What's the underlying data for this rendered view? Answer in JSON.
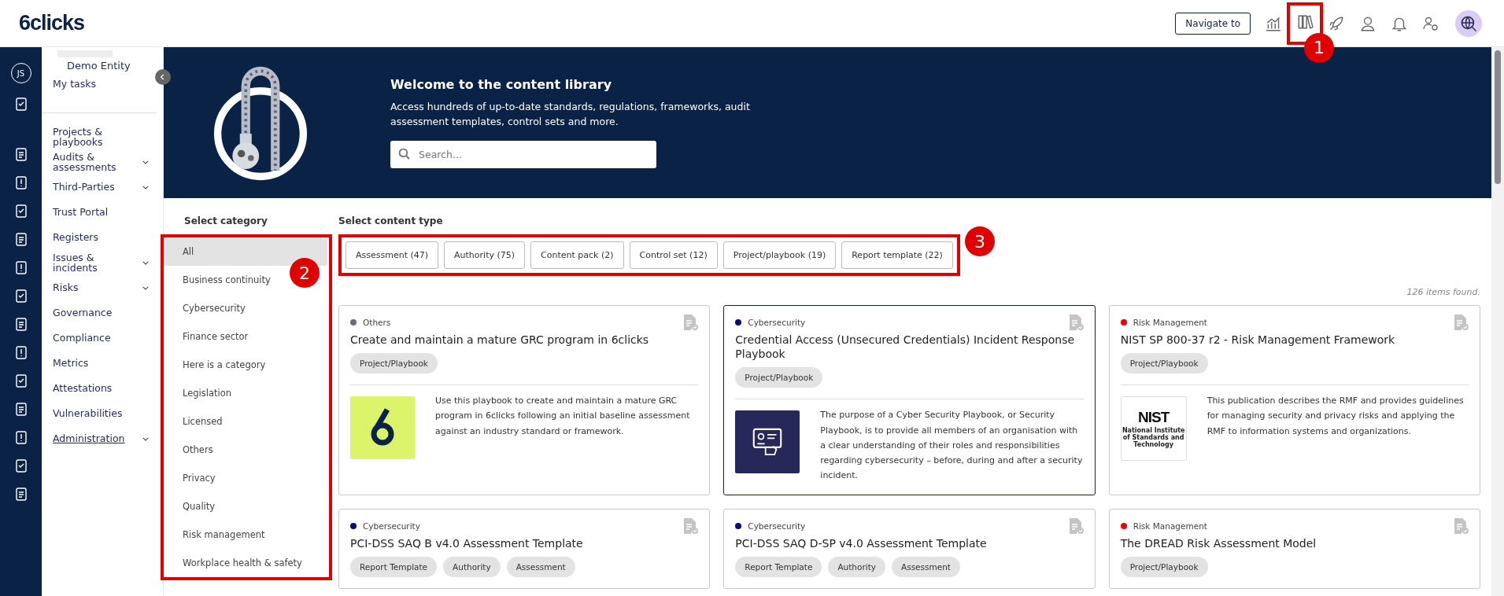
{
  "header": {
    "logo": "6clicks",
    "navigate_button": "Navigate to"
  },
  "rail": {
    "avatar_initials": "JS"
  },
  "nav": {
    "entity": "Demo Entity",
    "items": [
      {
        "label": "My tasks",
        "expandable": false,
        "hovered": false
      },
      {
        "label": "Projects & playbooks",
        "expandable": false,
        "hovered": false
      },
      {
        "label": "Audits & assessments",
        "expandable": true,
        "hovered": false
      },
      {
        "label": "Third-Parties",
        "expandable": true,
        "hovered": false
      },
      {
        "label": "Trust Portal",
        "expandable": false,
        "hovered": false
      },
      {
        "label": "Registers",
        "expandable": false,
        "hovered": false
      },
      {
        "label": "Issues & incidents",
        "expandable": true,
        "hovered": false
      },
      {
        "label": "Risks",
        "expandable": true,
        "hovered": false
      },
      {
        "label": "Governance",
        "expandable": false,
        "hovered": false
      },
      {
        "label": "Compliance",
        "expandable": false,
        "hovered": false
      },
      {
        "label": "Metrics",
        "expandable": false,
        "hovered": false
      },
      {
        "label": "Attestations",
        "expandable": false,
        "hovered": false
      },
      {
        "label": "Vulnerabilities",
        "expandable": false,
        "hovered": false
      },
      {
        "label": "Administration",
        "expandable": true,
        "hovered": true
      }
    ]
  },
  "hero": {
    "title": "Welcome to the content library",
    "text": "Access hundreds of up-to-date standards, regulations, frameworks, audit assessment templates, control sets and more.",
    "search": {
      "placeholder": "Search..."
    }
  },
  "categories": {
    "title": "Select category",
    "items": [
      {
        "label": "All",
        "selected": true
      },
      {
        "label": "Business continuity",
        "selected": false
      },
      {
        "label": "Cybersecurity",
        "selected": false
      },
      {
        "label": "Finance sector",
        "selected": false
      },
      {
        "label": "Here is a category",
        "selected": false
      },
      {
        "label": "Legislation",
        "selected": false
      },
      {
        "label": "Licensed",
        "selected": false
      },
      {
        "label": "Others",
        "selected": false
      },
      {
        "label": "Privacy",
        "selected": false
      },
      {
        "label": "Quality",
        "selected": false
      },
      {
        "label": "Risk management",
        "selected": false
      },
      {
        "label": "Workplace health & safety",
        "selected": false
      }
    ]
  },
  "content_types": {
    "title": "Select content type",
    "items": [
      "Assessment (47)",
      "Authority (75)",
      "Content pack (2)",
      "Control set (12)",
      "Project/playbook (19)",
      "Report template (22)"
    ]
  },
  "results_count": "126 items found.",
  "cards": [
    {
      "category": "Others",
      "color": "#6b6b7b",
      "title": "Create and maintain a mature GRC program in 6clicks",
      "tags": [
        "Project/Playbook"
      ],
      "thumbnail": {
        "kind": "logo"
      },
      "description": "Use this playbook to create and maintain a mature GRC program in 6clicks following an initial baseline assessment against an industry standard or framework.",
      "selected": false
    },
    {
      "category": "Cybersecurity",
      "color": "#0a0a7a",
      "title": "Credential Access (Unsecured Credentials) Incident Response Playbook",
      "tags": [
        "Project/Playbook"
      ],
      "thumbnail": {
        "kind": "icon"
      },
      "description": "The purpose of a Cyber Security Playbook, or Security Playbook, is to provide all members of an organisation with a clear understanding of their roles and responsibilities regarding cybersecurity – before, during and after a security incident.",
      "selected": true
    },
    {
      "category": "Risk Management",
      "color": "#f00000",
      "title": "NIST SP 800-37 r2 - Risk Management Framework",
      "tags": [
        "Project/Playbook"
      ],
      "thumbnail": {
        "kind": "wordmark",
        "word": "NIST",
        "caption": "National Institute of Standards and Technology"
      },
      "description": "This publication describes the RMF and provides guidelines for managing security and privacy risks and applying the RMF to information systems and organizations.",
      "selected": false
    },
    {
      "category": "Cybersecurity",
      "color": "#0a0a7a",
      "title": "PCI-DSS SAQ B v4.0 Assessment Template",
      "tags": [
        "Report Template",
        "Authority",
        "Assessment"
      ],
      "selected": false
    },
    {
      "category": "Cybersecurity",
      "color": "#0a0a7a",
      "title": "PCI-DSS SAQ D-SP v4.0 Assessment Template",
      "tags": [
        "Report Template",
        "Authority",
        "Assessment"
      ],
      "selected": false
    },
    {
      "category": "Risk Management",
      "color": "#f00000",
      "title": "The DREAD Risk Assessment Model",
      "tags": [
        "Project/Playbook"
      ],
      "selected": false
    }
  ],
  "callouts": [
    "1",
    "2",
    "3"
  ]
}
